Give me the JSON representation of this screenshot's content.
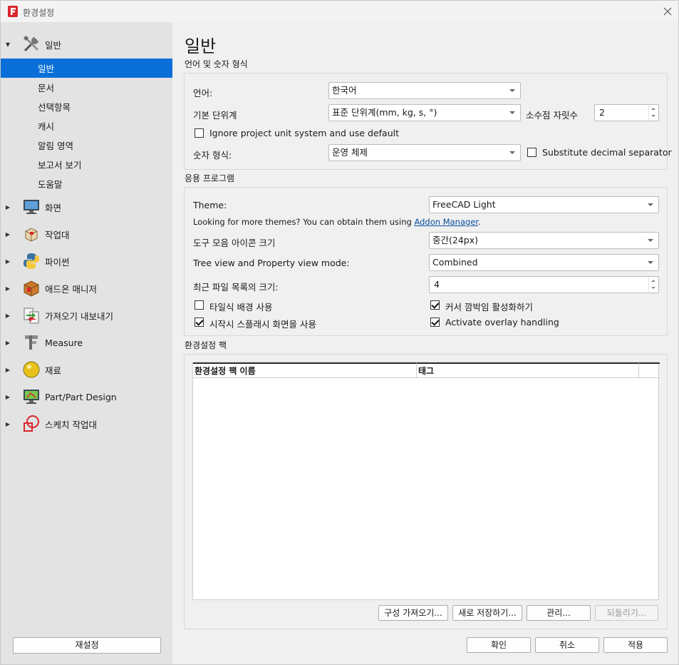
{
  "window": {
    "title": "환경설정"
  },
  "sidebar": {
    "categories": [
      {
        "label": "일반",
        "icon": "tools-icon",
        "expanded": true
      },
      {
        "label": "화면",
        "icon": "display-icon"
      },
      {
        "label": "작업대",
        "icon": "workbench-icon"
      },
      {
        "label": "파이썬",
        "icon": "python-icon"
      },
      {
        "label": "애드온 매니저",
        "icon": "addon-manager-icon"
      },
      {
        "label": "가져오기 내보내기",
        "icon": "import-export-icon"
      },
      {
        "label": "Measure",
        "icon": "measure-icon"
      },
      {
        "label": "재료",
        "icon": "material-icon"
      },
      {
        "label": "Part/Part Design",
        "icon": "part-design-icon"
      },
      {
        "label": "스케치 작업대",
        "icon": "sketcher-icon"
      }
    ],
    "sub_items": [
      "일반",
      "문서",
      "선택항목",
      "캐시",
      "알림 영역",
      "보고서 보기",
      "도움말"
    ],
    "selected_sub": "일반",
    "reset_label": "재설정"
  },
  "main": {
    "page_title": "일반",
    "language_group": {
      "title": "언어 및 숫자 형식",
      "language_label": "언어:",
      "language_value": "한국어",
      "unit_label": "기본 단위계",
      "unit_value": "표준 단위계(mm, kg, s, °)",
      "decimals_label": "소수점 자릿수",
      "decimals_value": "2",
      "ignore_unit_label": "Ignore project unit system and use default",
      "ignore_unit_checked": false,
      "number_format_label": "숫자 형식:",
      "number_format_value": "운영 체제",
      "substitute_label": "Substitute decimal separator",
      "substitute_checked": false
    },
    "app_group": {
      "title": "응용 프로그램",
      "theme_label": "Theme:",
      "theme_value": "FreeCAD Light",
      "more_themes_text": "Looking for more themes? You can obtain them using",
      "addon_link": "Addon Manager",
      "after_link": ".",
      "toolbar_icon_label": "도구 모음 아이콘 크기",
      "toolbar_icon_value": "중간(24px)",
      "tree_mode_label": "Tree view and Property view mode:",
      "tree_mode_value": "Combined",
      "recent_files_label": "최근 파일 목록의 크기:",
      "recent_files_value": "4",
      "tiled_bg_label": "타일식 배경 사용",
      "tiled_bg_checked": false,
      "cursor_blink_label": "커서 깜박임 활성화하기",
      "cursor_blink_checked": true,
      "splash_label": "시작시 스플래시 화면을 사용",
      "splash_checked": true,
      "overlay_label": "Activate overlay handling",
      "overlay_checked": true
    },
    "packs_group": {
      "title": "환경설정 팩",
      "columns": [
        "환경설정 팩 이름",
        "태그"
      ],
      "rows": [],
      "import_label": "구성 가져오기...",
      "save_new_label": "새로 저장하기...",
      "manage_label": "관리...",
      "revert_label": "되돌리기..."
    }
  },
  "footer": {
    "ok_label": "확인",
    "cancel_label": "취소",
    "apply_label": "적용"
  },
  "colors": {
    "selection": "#0a6fd8",
    "link": "#0a4ea0",
    "sidebar_bg": "#e3e3e3"
  }
}
